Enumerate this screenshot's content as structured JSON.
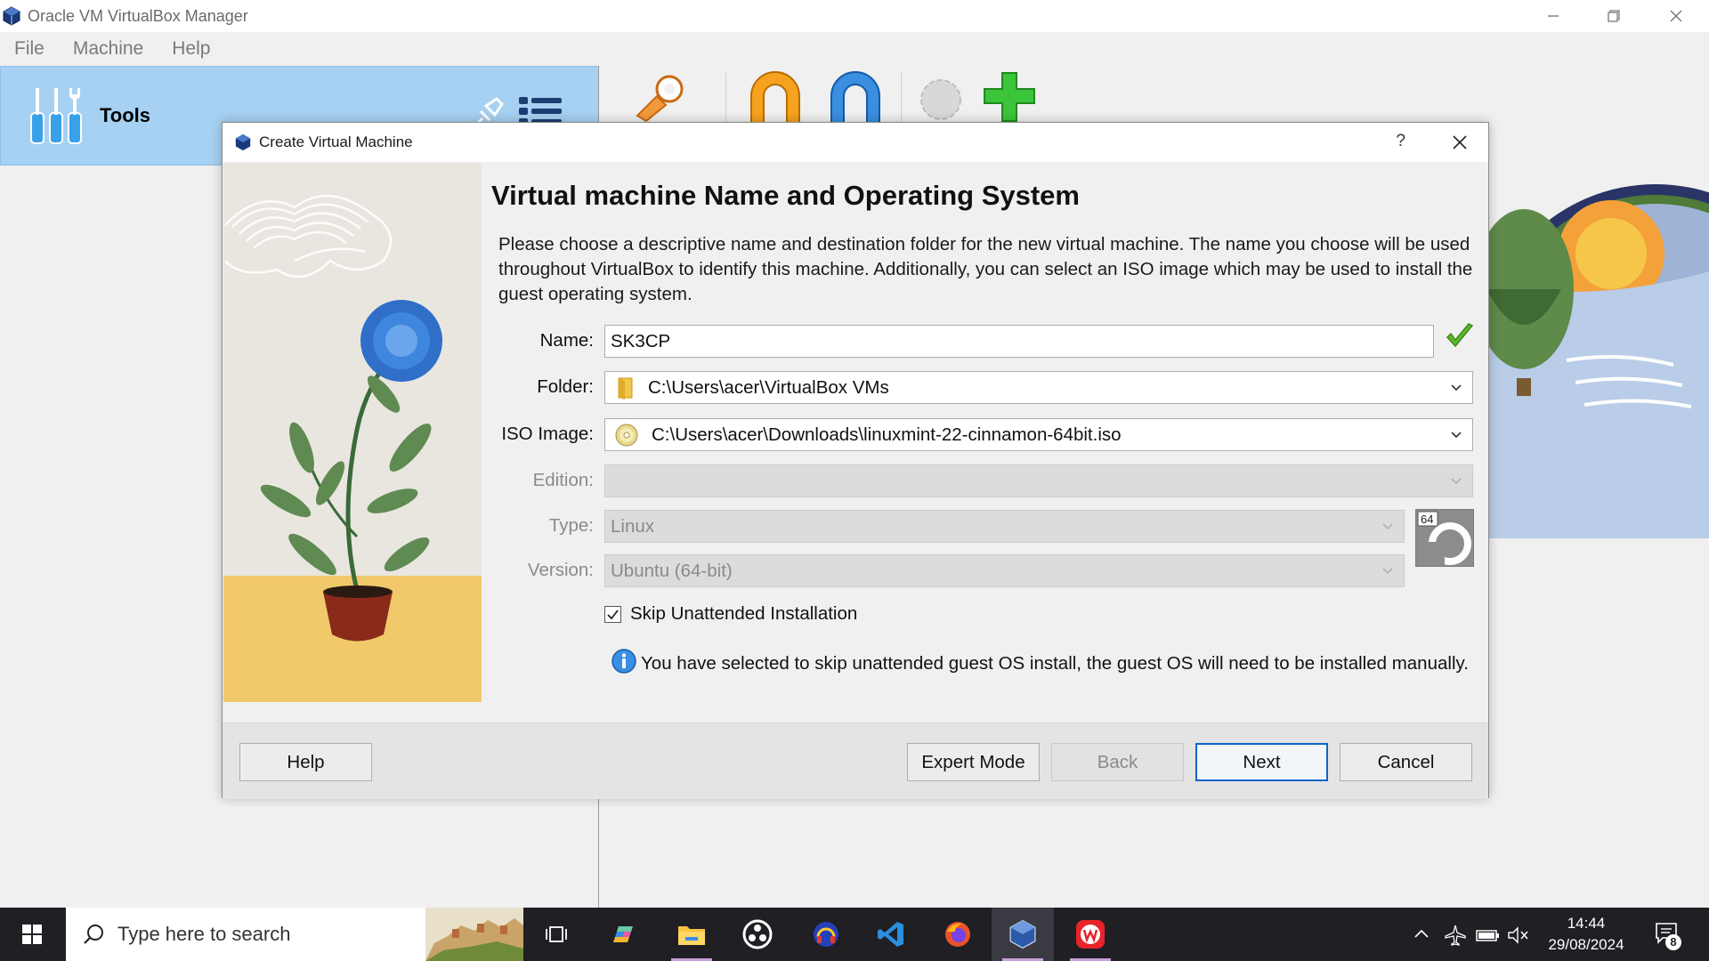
{
  "window": {
    "title": "Oracle VM VirtualBox Manager"
  },
  "menu": {
    "items": [
      "File",
      "Machine",
      "Help"
    ]
  },
  "tools_panel": {
    "label": "Tools"
  },
  "dialog": {
    "title": "Create Virtual Machine",
    "help_glyph": "?",
    "heading": "Virtual machine Name and Operating System",
    "description": "Please choose a descriptive name and destination folder for the new virtual machine. The name you choose will be used throughout VirtualBox to identify this machine. Additionally, you can select an ISO image which may be used to install the guest operating system.",
    "fields": {
      "name_label": "Name:",
      "name_value": "SK3CP",
      "folder_label": "Folder:",
      "folder_value": "C:\\Users\\acer\\VirtualBox VMs",
      "iso_label": "ISO Image:",
      "iso_value": "C:\\Users\\acer\\Downloads\\linuxmint-22-cinnamon-64bit.iso",
      "edition_label": "Edition:",
      "edition_value": "",
      "type_label": "Type:",
      "type_value": "Linux",
      "version_label": "Version:",
      "version_value": "Ubuntu (64-bit)",
      "os_badge_text": "64"
    },
    "skip_unattended": {
      "label": "Skip Unattended Installation",
      "checked": true
    },
    "info_message": "You have selected to skip unattended guest OS install, the guest OS will need to be installed manually.",
    "buttons": {
      "help": "Help",
      "expert_mode": "Expert Mode",
      "back": "Back",
      "next": "Next",
      "cancel": "Cancel"
    }
  },
  "taskbar": {
    "search_placeholder": "Type here to search",
    "apps": [
      "task-view",
      "copilot",
      "file-explorer",
      "obs-studio",
      "app-headphones",
      "vscode",
      "firefox",
      "virtualbox",
      "wps-office"
    ],
    "clock_time": "14:44",
    "clock_date": "29/08/2024",
    "notification_count": "8"
  },
  "colors": {
    "accent_blue": "#0a64c8",
    "tools_highlight": "#a6d1f2",
    "check_green": "#5cb82a",
    "taskbar_bg": "#1f1f24"
  }
}
